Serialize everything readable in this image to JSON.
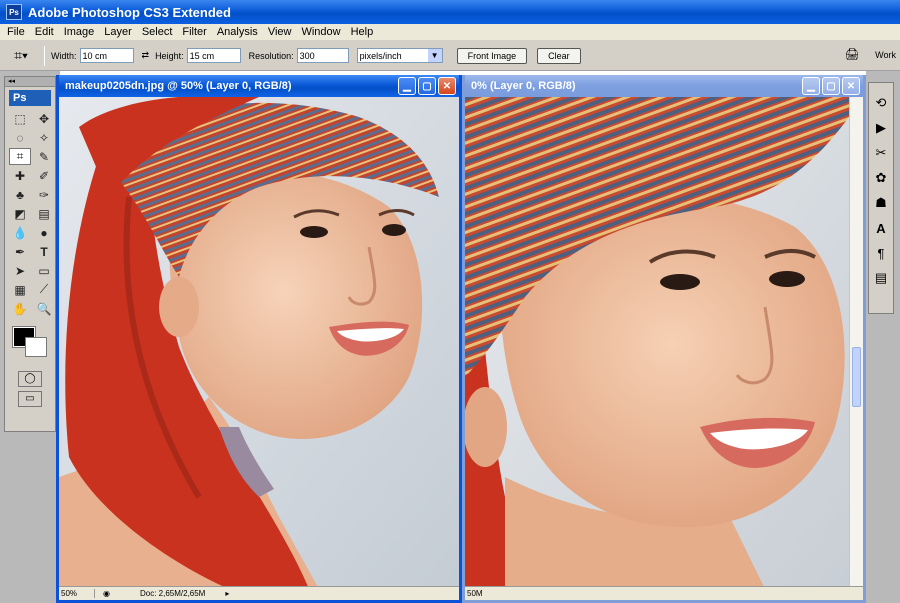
{
  "app": {
    "title": "Adobe Photoshop CS3 Extended",
    "logo_text": "Ps"
  },
  "menu": [
    "File",
    "Edit",
    "Image",
    "Layer",
    "Select",
    "Filter",
    "Analysis",
    "View",
    "Window",
    "Help"
  ],
  "options": {
    "width_label": "Width:",
    "width_value": "10 cm",
    "height_label": "Height:",
    "height_value": "15 cm",
    "resolution_label": "Resolution:",
    "resolution_value": "300",
    "units_value": "pixels/inch",
    "front_image_label": "Front Image",
    "clear_label": "Clear",
    "workspace_label": "Work"
  },
  "toolbox": {
    "badge": "Ps"
  },
  "doc1": {
    "title": "makeup0205dn.jpg @ 50% (Layer 0, RGB/8)",
    "zoom": "50%",
    "doc_size": "Doc: 2,65M/2,65M"
  },
  "doc2": {
    "title": "0% (Layer 0, RGB/8)",
    "zoom": "50M"
  },
  "colors": {
    "title_active": "#0a58d6",
    "title_inactive": "#7d9fe0",
    "scarf_red": "#c8321e",
    "skin": "#f0c4a6",
    "background": "#d8dde2"
  }
}
